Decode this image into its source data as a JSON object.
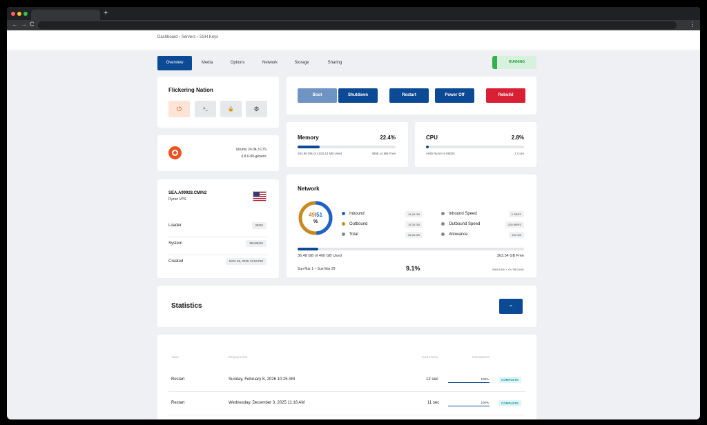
{
  "browser": {
    "new_tab": "+",
    "back": "←",
    "forward": "→",
    "reload": "C",
    "menu": "⋮"
  },
  "breadcrumb": [
    "Dashboard",
    "Servers",
    "SSH Keys"
  ],
  "breadcrumb_sep": "›",
  "tabs": [
    "Overview",
    "Media",
    "Options",
    "Network",
    "Storage",
    "Sharing"
  ],
  "status": {
    "label": "RUNNING",
    "color": "#34b04f"
  },
  "server": {
    "name": "Flickering Nation",
    "quick_actions": [
      {
        "icon": "power-icon",
        "glyph": "⏻"
      },
      {
        "icon": "terminal-icon",
        "glyph": ">_"
      },
      {
        "icon": "lock-icon",
        "glyph": "🔒"
      },
      {
        "icon": "gear-icon",
        "glyph": "⚙"
      }
    ]
  },
  "os": {
    "name": "Ubuntu 24.04.3 LTS",
    "kernel": "6.8.0-90-generic",
    "icon": "ubuntu-icon"
  },
  "location": {
    "host": "SEA.A99928.CMIN2",
    "plan": "Ryzen VPS",
    "flag_icon": "us-flag-icon",
    "rows": [
      {
        "label": "Loader",
        "value": "BIOS"
      },
      {
        "label": "System",
        "value": "SEABIOS"
      },
      {
        "label": "Created",
        "value": "NOV 26, 2025 12:53 PM"
      }
    ]
  },
  "actions": [
    {
      "label": "Boot",
      "color": "#6f93c3"
    },
    {
      "label": "Shutdown",
      "color": "#0d4a95"
    },
    {
      "label": "Restart",
      "color": "#0d4a95"
    },
    {
      "label": "Power Off",
      "color": "#0d4a95"
    },
    {
      "label": "Rebuild",
      "color": "#d91f34"
    }
  ],
  "memory": {
    "title": "Memory",
    "percent": "22.4%",
    "fill": 0.224,
    "used": "204.98 MB of 4103.13 MB Used",
    "free": "3898.14 MB Free"
  },
  "cpu": {
    "title": "CPU",
    "percent": "2.8%",
    "fill": 0.028,
    "model": "AMD Ryzen 9 5900X",
    "cores": "1 Core"
  },
  "network": {
    "title": "Network",
    "donut_value": "49",
    "donut_sep": "/",
    "donut_total": "51",
    "donut_unit": "%",
    "donut_inbound_frac": 0.49,
    "legend": [
      {
        "label": "Inbound",
        "value": "16.48 GB",
        "color": "#0d4a95"
      },
      {
        "label": "Outbound",
        "value": "19.33 GB",
        "color": "#c98b1f"
      },
      {
        "label": "Total",
        "value": "36.48 GB",
        "color": "#888888"
      }
    ],
    "right_legend": [
      {
        "label": "Inbound Speed",
        "value": "3 GBPS",
        "color": "#888888"
      },
      {
        "label": "Outbound Speed",
        "value": "200 MBPS",
        "color": "#888888"
      },
      {
        "label": "Allowance",
        "value": "400 GB",
        "color": "#888888"
      }
    ],
    "usage_fill": 0.091,
    "used": "36.48 GB of 400 GB Used",
    "free": "363.54 GB Free",
    "period": "Sun Mar 1 – Sun Mar 29",
    "usage_percent": "9.1%",
    "mode": "INBOUND + OUTBOUND"
  },
  "statistics": {
    "title": "Statistics",
    "dropdown_icon": "chevron-down-icon",
    "dropdown_glyph": "⌄"
  },
  "tasks": {
    "headers": [
      "TASK",
      "REQUESTED",
      "DURATION",
      "PROGRESS"
    ],
    "rows": [
      {
        "task": "Restart",
        "requested": "Sunday, February 8, 2026 10:25 AM",
        "duration": "12 sec",
        "progress": "100%",
        "progress_fill": 1.0,
        "status": "COMPLETE"
      },
      {
        "task": "Restart",
        "requested": "Wednesday, December 3, 2025 11:16 AM",
        "duration": "11 sec",
        "progress": "100%",
        "progress_fill": 1.0,
        "status": "COMPLETE"
      }
    ]
  }
}
